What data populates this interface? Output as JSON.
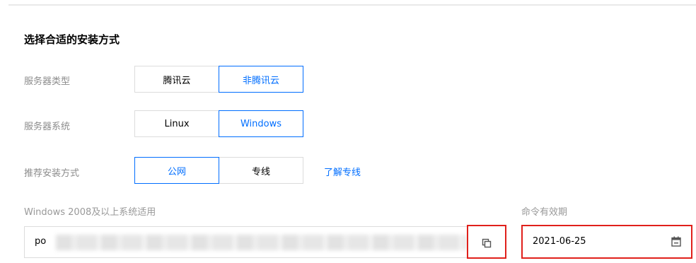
{
  "section_title": "选择合适的安装方式",
  "rows": {
    "server_type": {
      "label": "服务器类型",
      "options": [
        "腾讯云",
        "非腾讯云"
      ],
      "selected": "非腾讯云"
    },
    "server_os": {
      "label": "服务器系统",
      "options": [
        "Linux",
        "Windows"
      ],
      "selected": "Windows"
    },
    "install_method": {
      "label": "推荐安装方式",
      "options": [
        "公网",
        "专线"
      ],
      "selected": "公网",
      "link": "了解专线"
    }
  },
  "command": {
    "label": "Windows 2008及以上系统适用",
    "value_visible": "po",
    "copy_icon": "copy-icon"
  },
  "expiry": {
    "label": "命令有效期",
    "value": "2021-06-25",
    "icon": "calendar-icon"
  },
  "colors": {
    "accent": "#006eff",
    "highlight": "#e0201b"
  }
}
